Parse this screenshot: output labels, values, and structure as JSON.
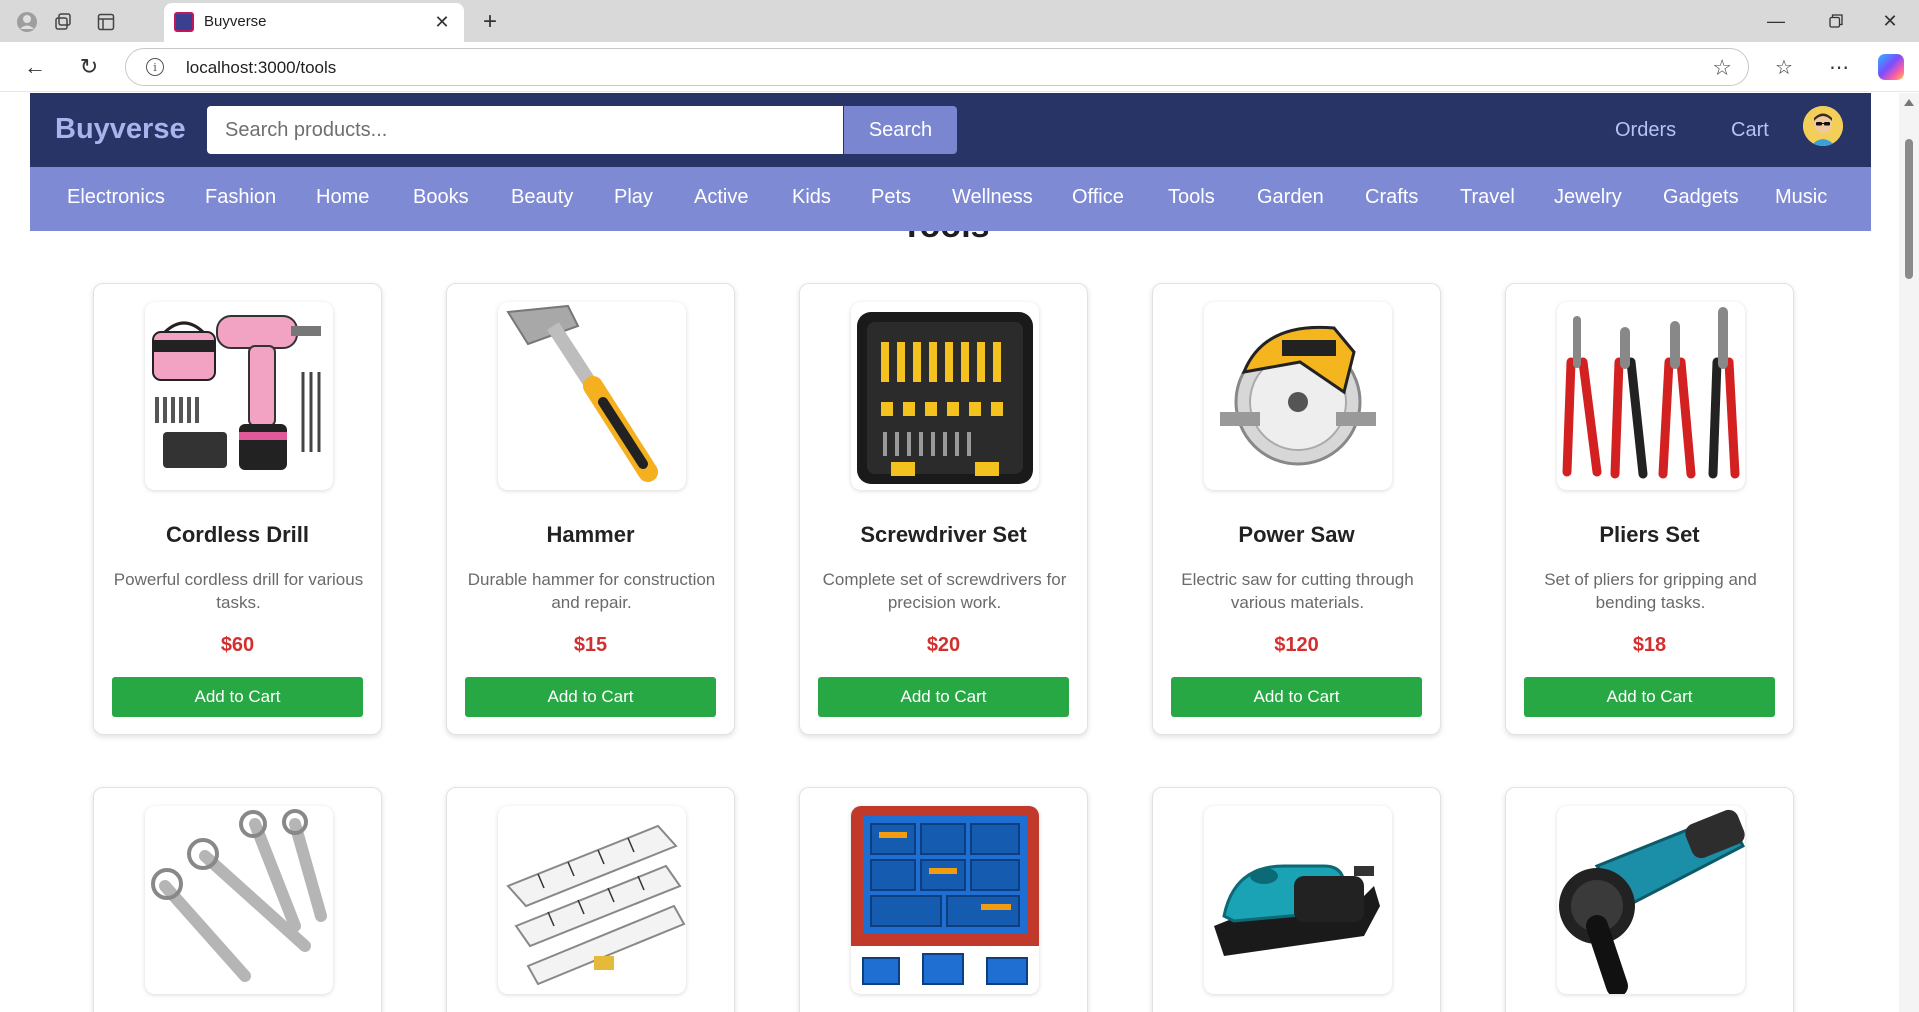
{
  "browser": {
    "tab_title": "Buyverse",
    "url": "localhost:3000/tools"
  },
  "header": {
    "brand": "Buyverse",
    "search_placeholder": "Search products...",
    "search_button": "Search",
    "orders_label": "Orders",
    "cart_label": "Cart"
  },
  "categories": [
    "Electronics",
    "Fashion",
    "Home",
    "Books",
    "Beauty",
    "Play",
    "Active",
    "Kids",
    "Pets",
    "Wellness",
    "Office",
    "Tools",
    "Garden",
    "Crafts",
    "Travel",
    "Jewelry",
    "Gadgets",
    "Music"
  ],
  "page": {
    "heading": "Tools"
  },
  "products": [
    {
      "name": "Cordless Drill",
      "description": "Powerful cordless drill for various tasks.",
      "price": "$60",
      "button": "Add to Cart",
      "icon": "drill-image"
    },
    {
      "name": "Hammer",
      "description": "Durable hammer for construction and repair.",
      "price": "$15",
      "button": "Add to Cart",
      "icon": "hammer-image"
    },
    {
      "name": "Screwdriver Set",
      "description": "Complete set of screwdrivers for precision work.",
      "price": "$20",
      "button": "Add to Cart",
      "icon": "screwdriver-set-image"
    },
    {
      "name": "Power Saw",
      "description": "Electric saw for cutting through various materials.",
      "price": "$120",
      "button": "Add to Cart",
      "icon": "power-saw-image"
    },
    {
      "name": "Pliers Set",
      "description": "Set of pliers for gripping and bending tasks.",
      "price": "$18",
      "button": "Add to Cart",
      "icon": "pliers-image"
    }
  ],
  "products_row2": [
    {
      "icon": "wrench-set-image"
    },
    {
      "icon": "measuring-tape-image"
    },
    {
      "icon": "tool-organizer-image"
    },
    {
      "icon": "sander-image"
    },
    {
      "icon": "angle-grinder-image"
    }
  ],
  "colors": {
    "header_bg": "#283466",
    "nav_bg": "#7f8ad4",
    "brand": "#a9b3ec",
    "price": "#d32f2f",
    "cart_button": "#28a745"
  }
}
